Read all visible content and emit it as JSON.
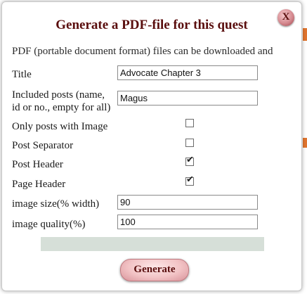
{
  "dialog": {
    "title": "Generate a PDF-file for this quest",
    "close_label": "X",
    "intro": "PDF (portable document format) files can be downloaded and"
  },
  "fields": {
    "title_label": "Title",
    "title_value": "Advocate Chapter 3",
    "posts_label_line1": "Included posts (name,",
    "posts_label_line2": "id or no., empty for all)",
    "posts_value": "Magus",
    "only_image_label": "Only posts with Image",
    "only_image_checked": false,
    "separator_label": "Post Separator",
    "separator_checked": false,
    "post_header_label": "Post Header",
    "post_header_checked": true,
    "page_header_label": "Page Header",
    "page_header_checked": true,
    "image_size_label": "image size(% width)",
    "image_size_value": "90",
    "image_quality_label": "image quality(%)",
    "image_quality_value": "100"
  },
  "actions": {
    "generate_label": "Generate"
  },
  "icons": {
    "close": "close-icon",
    "check": "checkmark-icon"
  },
  "colors": {
    "title": "#5a0e0e",
    "progress": "#d6dfd8",
    "button": "#f2c3c5"
  }
}
